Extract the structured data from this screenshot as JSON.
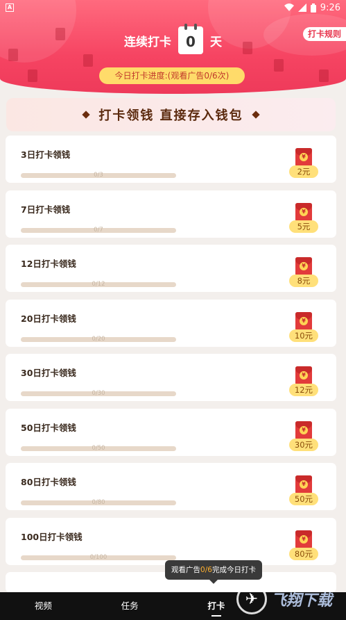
{
  "status": {
    "left_glyph": "A",
    "time": "9:26"
  },
  "header": {
    "rules_label": "打卡规则",
    "streak_prefix": "连续打卡",
    "streak_days": "0",
    "streak_suffix": "天",
    "progress_text": "今日打卡进度:(观看广告0/6次)"
  },
  "banner": {
    "title": "打卡领钱 直接存入钱包"
  },
  "cards": [
    {
      "title": "3日打卡领钱",
      "progress": "0/3",
      "progress_fraction": 0,
      "amount": "2元"
    },
    {
      "title": "7日打卡领钱",
      "progress": "0/7",
      "progress_fraction": 0,
      "amount": "5元"
    },
    {
      "title": "12日打卡领钱",
      "progress": "0/12",
      "progress_fraction": 0,
      "amount": "8元"
    },
    {
      "title": "20日打卡领钱",
      "progress": "0/20",
      "progress_fraction": 0,
      "amount": "10元"
    },
    {
      "title": "30日打卡领钱",
      "progress": "0/30",
      "progress_fraction": 0,
      "amount": "12元"
    },
    {
      "title": "50日打卡领钱",
      "progress": "0/50",
      "progress_fraction": 0,
      "amount": "30元"
    },
    {
      "title": "80日打卡领钱",
      "progress": "0/80",
      "progress_fraction": 0,
      "amount": "50元"
    },
    {
      "title": "100日打卡领钱",
      "progress": "0/100",
      "progress_fraction": 0,
      "amount": "80元"
    }
  ],
  "toast": {
    "prefix": "观看广告",
    "count": "0/6",
    "suffix": "完成今日打卡"
  },
  "nav": {
    "items": [
      "视频",
      "任务",
      "打卡",
      ""
    ],
    "active_index": 2
  },
  "watermark": {
    "text": "飞翔下载"
  },
  "colors": {
    "header_red": "#f64462",
    "pill_yellow": "#ffdb6a",
    "accent_brown": "#5b2a0e"
  }
}
